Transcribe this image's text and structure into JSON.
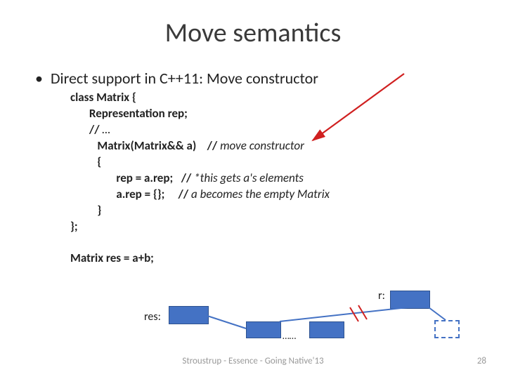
{
  "title": "Move semantics",
  "bullet": "Direct support in C++11: Move constructor",
  "code": {
    "l1": "class Matrix {",
    "l2": "       Representation rep;",
    "l3_a": "       // ",
    "l3_b": "…",
    "l4_a": "          Matrix(Matrix&& a)    // ",
    "l4_b": "move constructor",
    "l5": "          {",
    "l6_a": "                 rep = a.rep;   // ",
    "l6_b": "*this gets a's elements",
    "l7_a": "                 a.rep = {};     // ",
    "l7_b": "a becomes the empty Matrix",
    "l8": "          }",
    "l9": "};",
    "blank": "",
    "l10": "Matrix res = a+b;"
  },
  "labels": {
    "res": "res:",
    "r": "r:",
    "dots": "……"
  },
  "footer": "Stroustrup - Essence - Going Native'13",
  "pagenum": "28"
}
